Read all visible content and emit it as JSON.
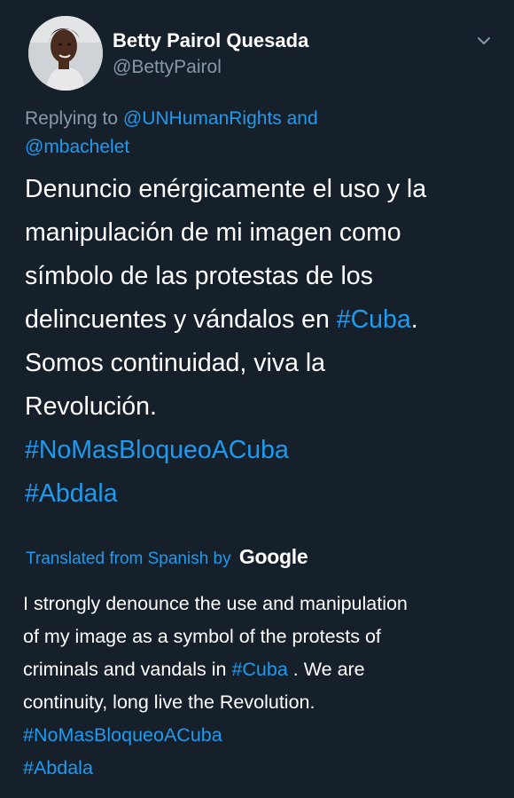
{
  "tweet": {
    "display_name": "Betty Pairol Quesada",
    "handle": "@BettyPairol",
    "replying_prefix": "Replying to",
    "reply_mention_1": "@UNHumanRights",
    "reply_and": "and",
    "reply_mention_2": "@mbachelet",
    "text_lines": [
      "Denuncio enérgicamente el uso y la",
      "manipulación de mi imagen  como",
      "símbolo de las protestas de los"
    ],
    "text_line4_prefix": "delincuentes y vándalos en",
    "text_line4_hashtag": "#Cuba",
    "text_line4_suffix": ".",
    "text_line5": "Somos continuidad, viva la",
    "text_line6": "Revolución.",
    "hashtag_1": "#NoMasBloqueoACuba",
    "hashtag_2": "#Abdala"
  },
  "translation": {
    "label": "Translated from Spanish by",
    "provider": "Google",
    "line1": "I strongly denounce the use and manipulation",
    "line2": "of my image as a symbol of the protests of",
    "line3_prefix": "criminals and vandals in",
    "line3_hashtag": "#Cuba",
    "line3_suffix": ". We are",
    "line4": "continuity, long live the Revolution.",
    "hashtag_1": "#NoMasBloqueoACuba",
    "hashtag_2": "#Abdala"
  },
  "icons": {
    "avatar": "avatar-photo",
    "menu": "chevron-down-icon"
  },
  "colors": {
    "background": "#15202b",
    "text": "#ffffff",
    "secondary_text": "#8899a6",
    "link": "#1d9bf0"
  }
}
